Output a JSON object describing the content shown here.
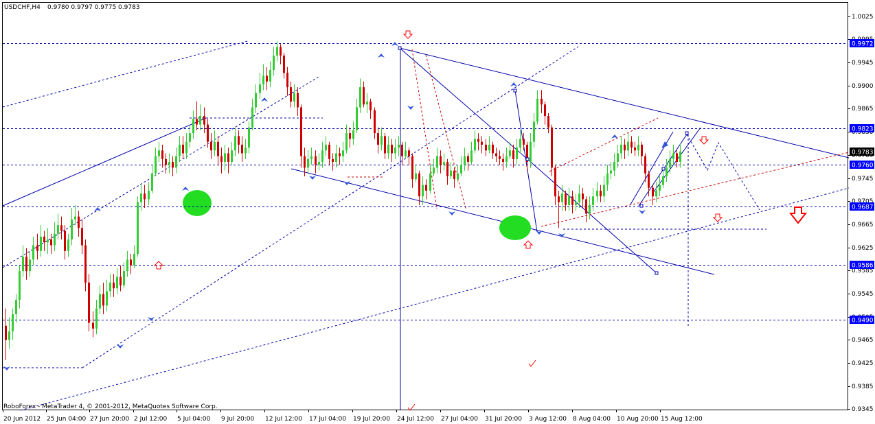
{
  "header": {
    "symbol": "USDCHF,H4",
    "ohlc": "0.9780 0.9797 0.9775 0.9783"
  },
  "footer": {
    "copyright": "RoboForex - MetaTrader 4, © 2001-2012, MetaQuotes Software Corp."
  },
  "colors": {
    "bull": "#33cc33",
    "bear": "#cc0000",
    "line": "#0000aa",
    "dash_red": "#cc0000",
    "marker": "#3355dd",
    "ellipse": "#22dd22",
    "arrow": "#ff0000",
    "tag_bg": "#0000ff",
    "price_tag_bg": "#000000"
  },
  "chart_data": {
    "type": "candlestick",
    "title": "USDCHF,H4",
    "ylim": [
      0.9334,
      1.0042
    ],
    "y_ticks": [
      "1.0025",
      "0.9995",
      "0.9945",
      "0.9900",
      "0.9865",
      "0.9830",
      "0.9785",
      "0.9745",
      "0.9705",
      "0.9665",
      "0.9625",
      "0.9585",
      "0.9545",
      "0.9505",
      "0.9465",
      "0.9425",
      "0.9385",
      "0.9345"
    ],
    "x_ticks": [
      "20 Jun 2012",
      "25 Jun 04:00",
      "27 Jun 20:00",
      "2 Jul 12:00",
      "5 Jul 04:00",
      "9 Jul 20:00",
      "12 Jul 12:00",
      "17 Jul 04:00",
      "19 Jul 20:00",
      "24 Jul 12:00",
      "27 Jul 04:00",
      "31 Jul 20:00",
      "3 Aug 12:00",
      "8 Aug 04:00",
      "10 Aug 20:00",
      "15 Aug 12:00"
    ],
    "levels": [
      {
        "label": "0.9972",
        "value": 0.9972
      },
      {
        "label": "0.9823",
        "value": 0.9823
      },
      {
        "label": "0.9760",
        "value": 0.976
      },
      {
        "label": "0.9687",
        "value": 0.9687
      },
      {
        "label": "0.9586",
        "value": 0.9586
      },
      {
        "label": "0.9490",
        "value": 0.949
      }
    ],
    "current_price": {
      "label": "0.9783",
      "value": 0.9783
    },
    "candles": [
      [
        0.948,
        0.9455,
        0.951,
        0.942
      ],
      [
        0.9455,
        0.947,
        0.9495,
        0.944
      ],
      [
        0.947,
        0.95,
        0.951,
        0.9455
      ],
      [
        0.95,
        0.9525,
        0.9535,
        0.9485
      ],
      [
        0.9525,
        0.9575,
        0.9585,
        0.951
      ],
      [
        0.9575,
        0.96,
        0.962,
        0.9565
      ],
      [
        0.96,
        0.9575,
        0.9615,
        0.956
      ],
      [
        0.9575,
        0.9595,
        0.961,
        0.9565
      ],
      [
        0.9595,
        0.962,
        0.9635,
        0.9585
      ],
      [
        0.962,
        0.961,
        0.964,
        0.9595
      ],
      [
        0.961,
        0.9635,
        0.9655,
        0.96
      ],
      [
        0.9635,
        0.9625,
        0.9645,
        0.961
      ],
      [
        0.9625,
        0.963,
        0.965,
        0.9605
      ],
      [
        0.963,
        0.962,
        0.964,
        0.9605
      ],
      [
        0.962,
        0.964,
        0.966,
        0.961
      ],
      [
        0.964,
        0.9655,
        0.9675,
        0.963
      ],
      [
        0.9655,
        0.9645,
        0.967,
        0.963
      ],
      [
        0.9645,
        0.961,
        0.9655,
        0.9595
      ],
      [
        0.961,
        0.963,
        0.964,
        0.96
      ],
      [
        0.963,
        0.9665,
        0.9685,
        0.962
      ],
      [
        0.9665,
        0.967,
        0.969,
        0.9655
      ],
      [
        0.967,
        0.965,
        0.968,
        0.9635
      ],
      [
        0.965,
        0.962,
        0.9665,
        0.9605
      ],
      [
        0.962,
        0.9555,
        0.963,
        0.954
      ],
      [
        0.9555,
        0.9485,
        0.957,
        0.947
      ],
      [
        0.9485,
        0.9475,
        0.9505,
        0.946
      ],
      [
        0.9475,
        0.951,
        0.9525,
        0.9465
      ],
      [
        0.951,
        0.9535,
        0.955,
        0.95
      ],
      [
        0.9535,
        0.9515,
        0.9555,
        0.95
      ],
      [
        0.9515,
        0.954,
        0.956,
        0.9505
      ],
      [
        0.954,
        0.9555,
        0.957,
        0.953
      ],
      [
        0.9555,
        0.9545,
        0.957,
        0.953
      ],
      [
        0.9545,
        0.9565,
        0.958,
        0.9535
      ],
      [
        0.9565,
        0.955,
        0.9585,
        0.954
      ],
      [
        0.955,
        0.9575,
        0.959,
        0.9545
      ],
      [
        0.9575,
        0.9595,
        0.961,
        0.9565
      ],
      [
        0.9595,
        0.9585,
        0.9605,
        0.957
      ],
      [
        0.9585,
        0.9605,
        0.962,
        0.958
      ],
      [
        0.9605,
        0.9695,
        0.9705,
        0.96
      ],
      [
        0.9695,
        0.971,
        0.9725,
        0.968
      ],
      [
        0.971,
        0.97,
        0.9725,
        0.9685
      ],
      [
        0.97,
        0.9715,
        0.973,
        0.969
      ],
      [
        0.9715,
        0.9745,
        0.976,
        0.971
      ],
      [
        0.9745,
        0.9775,
        0.979,
        0.974
      ],
      [
        0.9775,
        0.9785,
        0.98,
        0.9765
      ],
      [
        0.9785,
        0.977,
        0.9795,
        0.9755
      ],
      [
        0.977,
        0.976,
        0.978,
        0.9745
      ],
      [
        0.976,
        0.9765,
        0.978,
        0.9745
      ],
      [
        0.9765,
        0.9755,
        0.9775,
        0.974
      ],
      [
        0.9755,
        0.9775,
        0.979,
        0.9745
      ],
      [
        0.9775,
        0.9795,
        0.981,
        0.9765
      ],
      [
        0.9795,
        0.978,
        0.981,
        0.977
      ],
      [
        0.978,
        0.98,
        0.9815,
        0.977
      ],
      [
        0.98,
        0.9815,
        0.983,
        0.979
      ],
      [
        0.9815,
        0.984,
        0.9855,
        0.9805
      ],
      [
        0.984,
        0.983,
        0.987,
        0.982
      ],
      [
        0.983,
        0.9845,
        0.9865,
        0.982
      ],
      [
        0.9845,
        0.983,
        0.986,
        0.9815
      ],
      [
        0.983,
        0.98,
        0.984,
        0.979
      ],
      [
        0.98,
        0.9785,
        0.9815,
        0.977
      ],
      [
        0.9785,
        0.98,
        0.982,
        0.9775
      ],
      [
        0.98,
        0.9775,
        0.981,
        0.976
      ],
      [
        0.9775,
        0.9765,
        0.979,
        0.9745
      ],
      [
        0.9765,
        0.978,
        0.9795,
        0.975
      ],
      [
        0.978,
        0.9765,
        0.979,
        0.9745
      ],
      [
        0.9765,
        0.9785,
        0.98,
        0.976
      ],
      [
        0.9785,
        0.981,
        0.9825,
        0.9775
      ],
      [
        0.981,
        0.9795,
        0.982,
        0.978
      ],
      [
        0.9795,
        0.978,
        0.981,
        0.9765
      ],
      [
        0.978,
        0.979,
        0.9805,
        0.977
      ],
      [
        0.979,
        0.9825,
        0.9835,
        0.978
      ],
      [
        0.9825,
        0.986,
        0.9875,
        0.982
      ],
      [
        0.986,
        0.9885,
        0.99,
        0.985
      ],
      [
        0.9885,
        0.99,
        0.992,
        0.9875
      ],
      [
        0.99,
        0.9915,
        0.9935,
        0.989
      ],
      [
        0.9915,
        0.9905,
        0.993,
        0.989
      ],
      [
        0.9905,
        0.9925,
        0.994,
        0.9895
      ],
      [
        0.9925,
        0.995,
        0.9965,
        0.9915
      ],
      [
        0.995,
        0.9965,
        0.9975,
        0.994
      ],
      [
        0.9965,
        0.995,
        0.997,
        0.9935
      ],
      [
        0.995,
        0.992,
        0.9955,
        0.991
      ],
      [
        0.992,
        0.9895,
        0.993,
        0.988
      ],
      [
        0.9895,
        0.987,
        0.9905,
        0.986
      ],
      [
        0.987,
        0.9885,
        0.99,
        0.986
      ],
      [
        0.9885,
        0.986,
        0.9895,
        0.9845
      ],
      [
        0.986,
        0.9775,
        0.9865,
        0.9755
      ],
      [
        0.9775,
        0.9755,
        0.979,
        0.974
      ],
      [
        0.9755,
        0.977,
        0.9785,
        0.9745
      ],
      [
        0.977,
        0.9775,
        0.979,
        0.976
      ],
      [
        0.9775,
        0.976,
        0.9785,
        0.9745
      ],
      [
        0.976,
        0.9765,
        0.978,
        0.975
      ],
      [
        0.9765,
        0.9785,
        0.98,
        0.9755
      ],
      [
        0.9785,
        0.9795,
        0.981,
        0.9775
      ],
      [
        0.9795,
        0.977,
        0.98,
        0.976
      ],
      [
        0.977,
        0.9765,
        0.978,
        0.975
      ],
      [
        0.9765,
        0.978,
        0.9795,
        0.9755
      ],
      [
        0.978,
        0.9775,
        0.979,
        0.976
      ],
      [
        0.9775,
        0.9785,
        0.98,
        0.9765
      ],
      [
        0.9785,
        0.9815,
        0.983,
        0.978
      ],
      [
        0.9815,
        0.9805,
        0.9825,
        0.979
      ],
      [
        0.9805,
        0.982,
        0.9835,
        0.9795
      ],
      [
        0.982,
        0.986,
        0.9875,
        0.9815
      ],
      [
        0.986,
        0.9895,
        0.991,
        0.985
      ],
      [
        0.9895,
        0.9865,
        0.9905,
        0.986
      ],
      [
        0.9865,
        0.987,
        0.9885,
        0.985
      ],
      [
        0.987,
        0.9855,
        0.9875,
        0.984
      ],
      [
        0.9855,
        0.9815,
        0.986,
        0.9805
      ],
      [
        0.9815,
        0.9795,
        0.9825,
        0.978
      ],
      [
        0.9795,
        0.981,
        0.9825,
        0.9785
      ],
      [
        0.981,
        0.978,
        0.9815,
        0.977
      ],
      [
        0.978,
        0.9795,
        0.981,
        0.977
      ],
      [
        0.9795,
        0.978,
        0.9805,
        0.9765
      ],
      [
        0.978,
        0.979,
        0.9805,
        0.977
      ],
      [
        0.979,
        0.9795,
        0.981,
        0.9775
      ],
      [
        0.9795,
        0.9775,
        0.98,
        0.976
      ],
      [
        0.9775,
        0.9785,
        0.98,
        0.977
      ],
      [
        0.9785,
        0.9775,
        0.979,
        0.976
      ],
      [
        0.9775,
        0.9735,
        0.978,
        0.972
      ],
      [
        0.9735,
        0.9745,
        0.976,
        0.973
      ],
      [
        0.9745,
        0.9705,
        0.975,
        0.969
      ],
      [
        0.9705,
        0.9725,
        0.974,
        0.969
      ],
      [
        0.9725,
        0.9715,
        0.9735,
        0.97
      ],
      [
        0.9715,
        0.9745,
        0.976,
        0.971
      ],
      [
        0.9745,
        0.9755,
        0.977,
        0.974
      ],
      [
        0.9755,
        0.9775,
        0.979,
        0.9745
      ],
      [
        0.9775,
        0.976,
        0.9785,
        0.9745
      ],
      [
        0.976,
        0.9765,
        0.978,
        0.975
      ],
      [
        0.9765,
        0.974,
        0.977,
        0.9725
      ],
      [
        0.974,
        0.975,
        0.9765,
        0.9735
      ],
      [
        0.975,
        0.9735,
        0.9755,
        0.972
      ],
      [
        0.9735,
        0.9745,
        0.976,
        0.973
      ],
      [
        0.9745,
        0.976,
        0.9775,
        0.974
      ],
      [
        0.976,
        0.9775,
        0.979,
        0.975
      ],
      [
        0.9775,
        0.9765,
        0.978,
        0.975
      ],
      [
        0.9765,
        0.9785,
        0.98,
        0.976
      ],
      [
        0.9785,
        0.9805,
        0.982,
        0.978
      ],
      [
        0.9805,
        0.98,
        0.9815,
        0.9785
      ],
      [
        0.98,
        0.9795,
        0.981,
        0.978
      ],
      [
        0.9795,
        0.9785,
        0.9805,
        0.9775
      ],
      [
        0.9785,
        0.9795,
        0.981,
        0.978
      ],
      [
        0.9795,
        0.978,
        0.98,
        0.977
      ],
      [
        0.978,
        0.9775,
        0.979,
        0.9765
      ],
      [
        0.9775,
        0.977,
        0.9785,
        0.976
      ],
      [
        0.977,
        0.9765,
        0.978,
        0.975
      ],
      [
        0.9765,
        0.9775,
        0.979,
        0.9755
      ],
      [
        0.9775,
        0.9785,
        0.98,
        0.977
      ],
      [
        0.9785,
        0.977,
        0.9795,
        0.9755
      ],
      [
        0.977,
        0.979,
        0.9805,
        0.976
      ],
      [
        0.979,
        0.9805,
        0.982,
        0.978
      ],
      [
        0.9805,
        0.9795,
        0.9815,
        0.9785
      ],
      [
        0.9795,
        0.9765,
        0.98,
        0.975
      ],
      [
        0.9765,
        0.98,
        0.9815,
        0.9755
      ],
      [
        0.98,
        0.9835,
        0.985,
        0.979
      ],
      [
        0.9835,
        0.9875,
        0.989,
        0.983
      ],
      [
        0.9875,
        0.9865,
        0.989,
        0.985
      ],
      [
        0.9865,
        0.9845,
        0.987,
        0.983
      ],
      [
        0.9845,
        0.9825,
        0.985,
        0.9815
      ],
      [
        0.9825,
        0.9755,
        0.983,
        0.974
      ],
      [
        0.9755,
        0.9705,
        0.976,
        0.969
      ],
      [
        0.9705,
        0.9695,
        0.9715,
        0.965
      ],
      [
        0.9695,
        0.971,
        0.9725,
        0.968
      ],
      [
        0.971,
        0.969,
        0.9715,
        0.968
      ],
      [
        0.969,
        0.9705,
        0.972,
        0.968
      ],
      [
        0.9705,
        0.969,
        0.9715,
        0.9675
      ],
      [
        0.969,
        0.9695,
        0.971,
        0.968
      ],
      [
        0.9695,
        0.971,
        0.9725,
        0.9685
      ],
      [
        0.971,
        0.97,
        0.972,
        0.9685
      ],
      [
        0.97,
        0.9675,
        0.9705,
        0.966
      ],
      [
        0.9675,
        0.969,
        0.9705,
        0.9665
      ],
      [
        0.969,
        0.9705,
        0.972,
        0.968
      ],
      [
        0.9705,
        0.9715,
        0.973,
        0.9695
      ],
      [
        0.9715,
        0.9705,
        0.9725,
        0.9695
      ],
      [
        0.9705,
        0.9725,
        0.974,
        0.9695
      ],
      [
        0.9725,
        0.9745,
        0.976,
        0.9715
      ],
      [
        0.9745,
        0.975,
        0.9765,
        0.9735
      ],
      [
        0.975,
        0.9765,
        0.978,
        0.974
      ],
      [
        0.9765,
        0.978,
        0.9795,
        0.9755
      ],
      [
        0.978,
        0.9795,
        0.981,
        0.977
      ],
      [
        0.9795,
        0.9785,
        0.9805,
        0.977
      ],
      [
        0.9785,
        0.98,
        0.9815,
        0.9775
      ],
      [
        0.98,
        0.979,
        0.981,
        0.978
      ],
      [
        0.979,
        0.9785,
        0.98,
        0.9775
      ],
      [
        0.9785,
        0.9795,
        0.981,
        0.9775
      ],
      [
        0.9795,
        0.9775,
        0.98,
        0.976
      ],
      [
        0.9775,
        0.9745,
        0.978,
        0.973
      ],
      [
        0.9745,
        0.972,
        0.975,
        0.9705
      ],
      [
        0.972,
        0.9705,
        0.9725,
        0.969
      ],
      [
        0.9705,
        0.9715,
        0.973,
        0.9695
      ],
      [
        0.9715,
        0.9725,
        0.974,
        0.9705
      ],
      [
        0.9725,
        0.974,
        0.9755,
        0.972
      ],
      [
        0.974,
        0.9755,
        0.977,
        0.973
      ],
      [
        0.9755,
        0.977,
        0.9785,
        0.9745
      ],
      [
        0.977,
        0.978,
        0.9795,
        0.976
      ],
      [
        0.978,
        0.9765,
        0.9785,
        0.9755
      ],
      [
        0.9765,
        0.9783,
        0.9797,
        0.9755
      ]
    ]
  }
}
